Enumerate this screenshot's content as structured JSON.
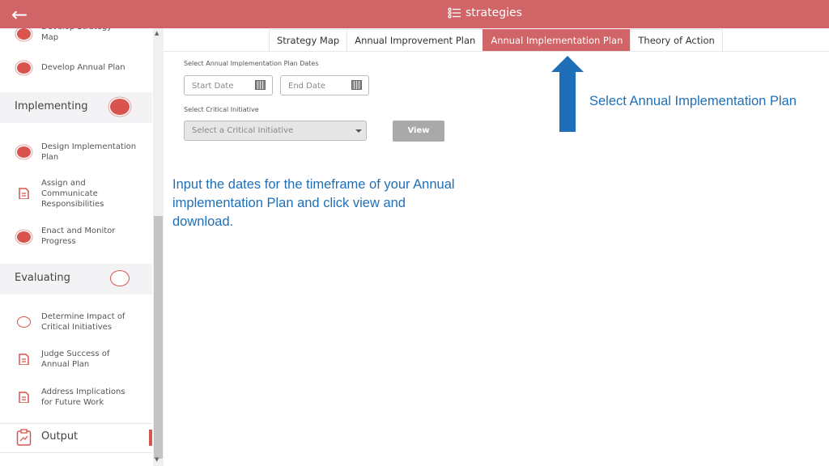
{
  "header": {
    "title": "strategies",
    "back_icon": "arrow-left-icon",
    "title_icon": "list-icon",
    "color": "#d06466"
  },
  "sidebar": {
    "items_top": [
      {
        "label": "Develop Strategy Map",
        "icon": "filled-circle"
      },
      {
        "label": "Develop Annual Plan",
        "icon": "filled-circle"
      }
    ],
    "sections": [
      {
        "label": "Implementing",
        "status": "filled",
        "items": [
          {
            "label": "Design Implementation Plan",
            "icon": "filled-circle"
          },
          {
            "label": "Assign and Communicate Responsibilities",
            "icon": "document"
          },
          {
            "label": "Enact and Monitor Progress",
            "icon": "filled-circle"
          }
        ]
      },
      {
        "label": "Evaluating",
        "status": "empty",
        "items": [
          {
            "label": "Determine Impact of Critical Initiatives",
            "icon": "empty-circle"
          },
          {
            "label": "Judge Success of Annual Plan",
            "icon": "document"
          },
          {
            "label": "Address Implications for Future Work",
            "icon": "document"
          }
        ]
      }
    ],
    "output": {
      "label": "Output"
    }
  },
  "tabs": [
    {
      "label": "Strategy Map"
    },
    {
      "label": "Annual Improvement Plan"
    },
    {
      "label": "Annual Implementation Plan",
      "active": true
    },
    {
      "label": "Theory of Action"
    }
  ],
  "form": {
    "dates_label": "Select Annual Implementation Plan Dates",
    "start_placeholder": "Start Date",
    "end_placeholder": "End Date",
    "initiative_label": "Select Critical Initiative",
    "initiative_placeholder": "Select a Critical Initiative",
    "view_label": "View"
  },
  "annotations": {
    "tab_note": "Select Annual Implementation Plan",
    "form_note": "Input the dates for the timeframe of your Annual implementation Plan and click view and download.",
    "color": "#1f6fb8"
  }
}
